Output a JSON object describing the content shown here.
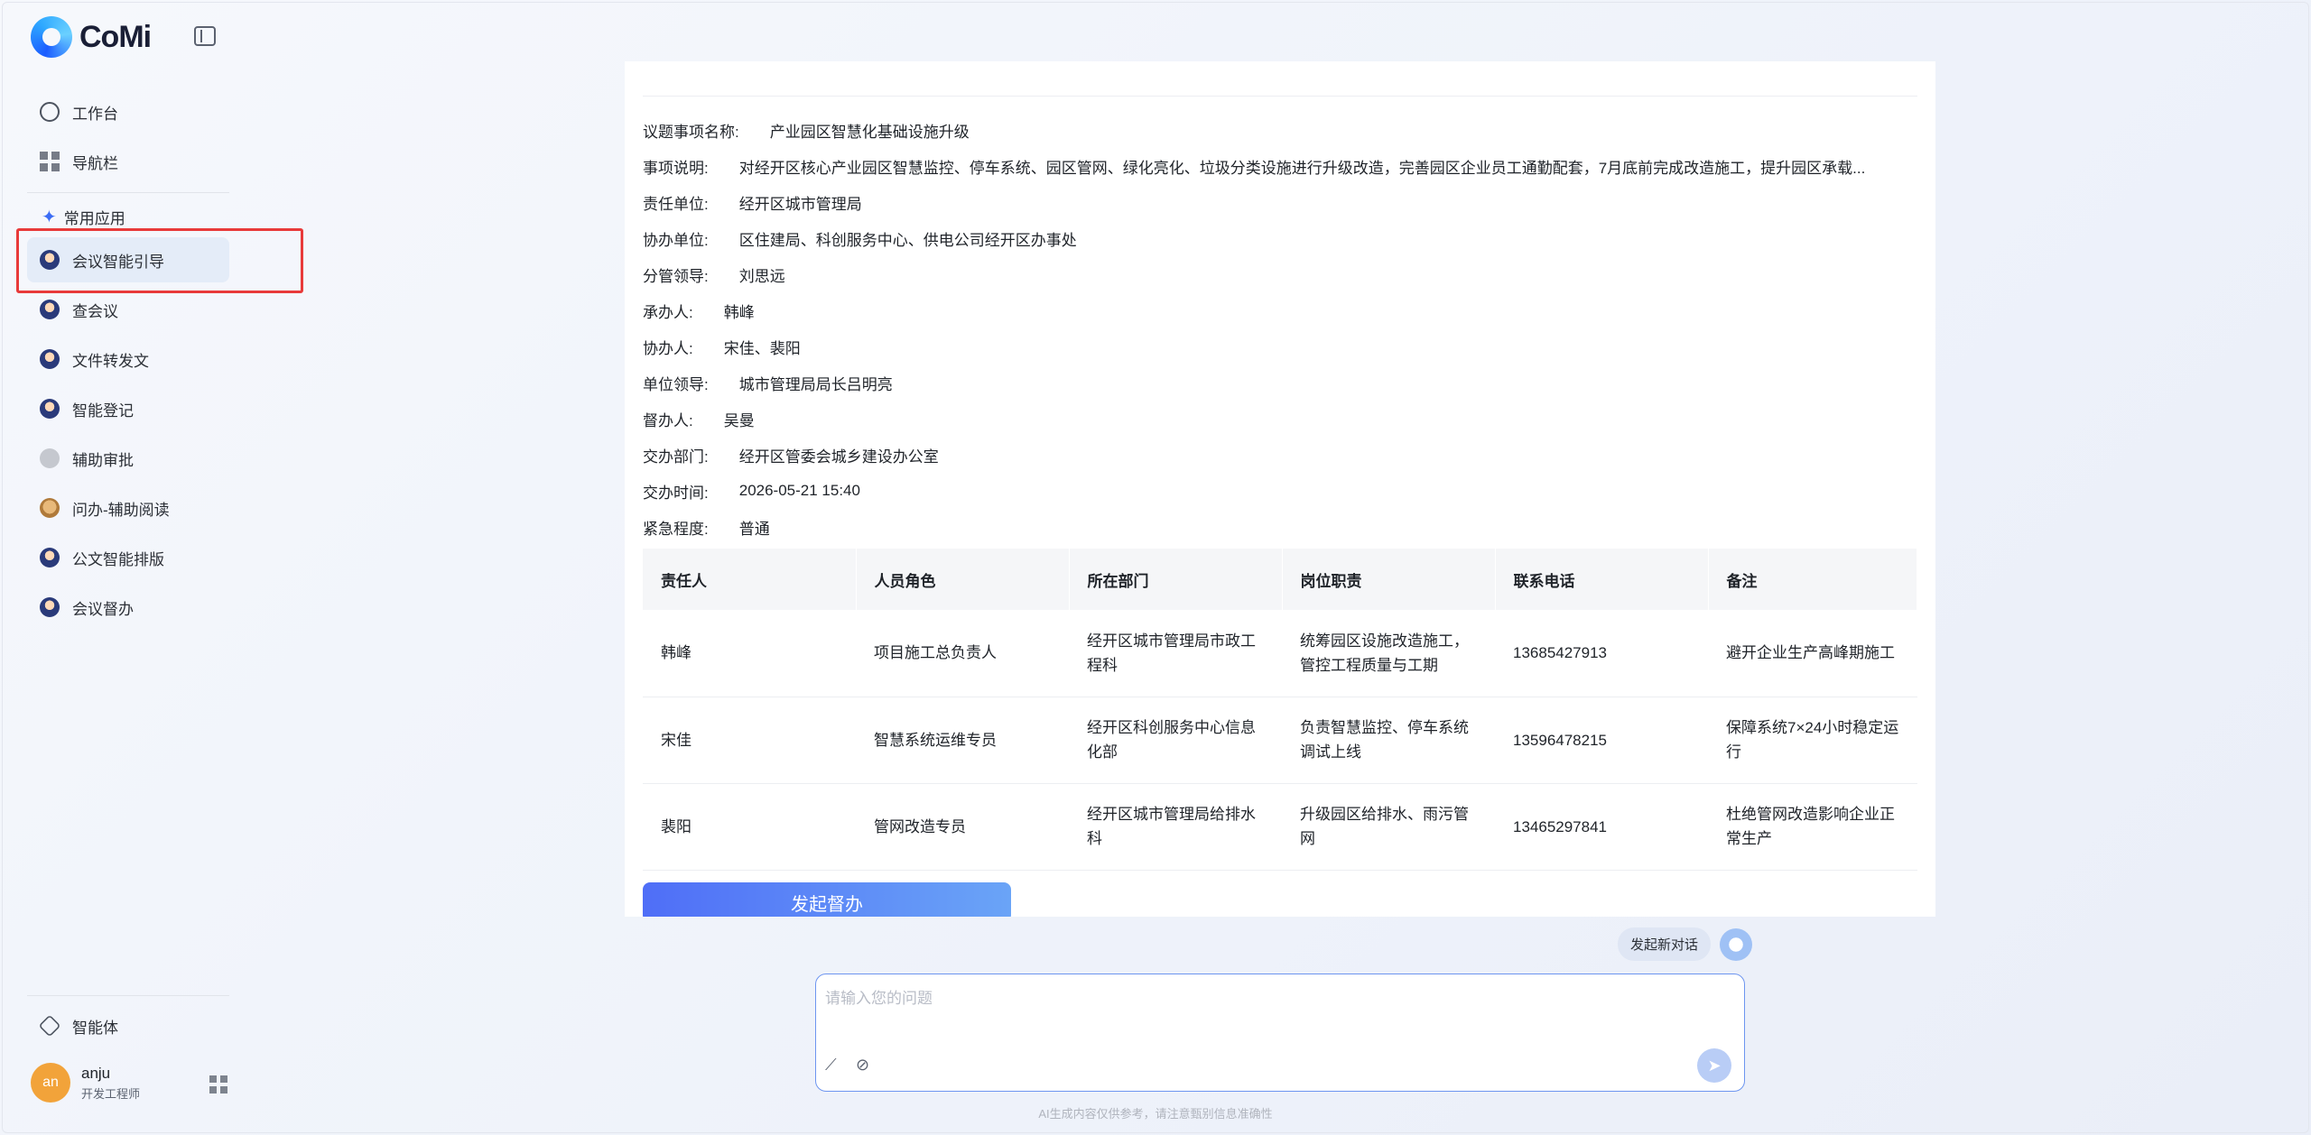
{
  "brand": {
    "logo_text": "CoMi"
  },
  "sidebar": {
    "top_items": [
      {
        "label": "工作台",
        "icon": "clock-icon"
      },
      {
        "label": "导航栏",
        "icon": "grid-icon"
      }
    ],
    "section_label": "常用应用",
    "apps": [
      {
        "label": "会议智能引导",
        "icon": "avatar-icon",
        "active": true
      },
      {
        "label": "查会议",
        "icon": "avatar-icon"
      },
      {
        "label": "文件转发文",
        "icon": "avatar-icon"
      },
      {
        "label": "智能登记",
        "icon": "avatar-icon"
      },
      {
        "label": "辅助审批",
        "icon": "gray-circle-icon"
      },
      {
        "label": "问办-辅助阅读",
        "icon": "dog-icon"
      },
      {
        "label": "公文智能排版",
        "icon": "avatar-icon"
      },
      {
        "label": "会议督办",
        "icon": "avatar-icon"
      }
    ],
    "agent_label": "智能体",
    "user": {
      "avatar_text": "an",
      "name": "anju",
      "role": "开发工程师"
    }
  },
  "details": [
    {
      "label": "议题事项名称:",
      "value": "产业园区智慧化基础设施升级"
    },
    {
      "label": "事项说明:",
      "value": "对经开区核心产业园区智慧监控、停车系统、园区管网、绿化亮化、垃圾分类设施进行升级改造，完善园区企业员工通勤配套，7月底前完成改造施工，提升园区承载..."
    },
    {
      "label": "责任单位:",
      "value": "经开区城市管理局"
    },
    {
      "label": "协办单位:",
      "value": "区住建局、科创服务中心、供电公司经开区办事处"
    },
    {
      "label": "分管领导:",
      "value": "刘思远"
    },
    {
      "label": "承办人:",
      "value": "韩峰"
    },
    {
      "label": "协办人:",
      "value": "宋佳、裴阳"
    },
    {
      "label": "单位领导:",
      "value": "城市管理局局长吕明亮"
    },
    {
      "label": "督办人:",
      "value": "吴曼"
    },
    {
      "label": "交办部门:",
      "value": "经开区管委会城乡建设办公室"
    },
    {
      "label": "交办时间:",
      "value": "2026-05-21 15:40"
    },
    {
      "label": "紧急程度:",
      "value": "普通"
    }
  ],
  "table": {
    "headers": [
      "责任人",
      "人员角色",
      "所在部门",
      "岗位职责",
      "联系电话",
      "备注"
    ],
    "rows": [
      [
        "韩峰",
        "项目施工总负责人",
        "经开区城市管理局市政工程科",
        "统筹园区设施改造施工，管控工程质量与工期",
        "13685427913",
        "避开企业生产高峰期施工"
      ],
      [
        "宋佳",
        "智慧系统运维专员",
        "经开区科创服务中心信息化部",
        "负责智慧监控、停车系统调试上线",
        "13596478215",
        "保障系统7×24小时稳定运行"
      ],
      [
        "裴阳",
        "管网改造专员",
        "经开区城市管理局给排水科",
        "升级园区给排水、雨污管网",
        "13465297841",
        "杜绝管网改造影响企业正常生产"
      ]
    ]
  },
  "submit_label": "发起督办",
  "new_chat_label": "发起新对话",
  "input": {
    "placeholder": "请输入您的问题",
    "value": ""
  },
  "disclaimer": "AI生成内容仅供参考，请注意甄别信息准确性"
}
